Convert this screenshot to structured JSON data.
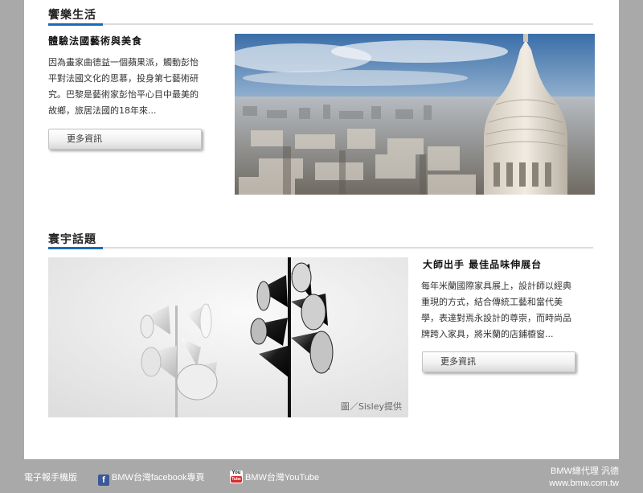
{
  "sections": {
    "lifestyle": {
      "heading": "饗樂生活",
      "article_title": "體驗法國藝術與美食",
      "article_body": [
        "因為畫家曲德益一個蘋果派，觸動彭怡",
        "平對法國文化的思慕，投身第七藝術研",
        "究。巴黎是藝術家彭怡平心目中最美的",
        "故鄉，旅居法國的18年來..."
      ],
      "more_label": "更多資訊"
    },
    "world": {
      "heading": "寰宇話題",
      "article_title": "大師出手  最佳品味伸展台",
      "article_body": [
        "每年米蘭國際家具展上，設計師以經典",
        "重現的方式，結合傳統工藝和當代美",
        "學，表達對焉永設計的尊崇，而時尚品",
        "牌跨入家具，將米蘭的店鋪櫥窗..."
      ],
      "more_label": "更多資訊",
      "photo_credit": "圖／Sisley提供"
    }
  },
  "footer": {
    "mobile_label": "電子報手機版",
    "facebook_label": "BMW台灣facebook專頁",
    "youtube_label": "BMW台灣YouTube",
    "dealer_line1": "BMW總代理 汎德",
    "dealer_line2": "www.bmw.com.tw"
  },
  "icons": [
    "facebook-icon",
    "youtube-icon"
  ],
  "colors": {
    "accent_blue": "#1c69b8",
    "background": "#a9a9a9",
    "panel": "#ffffff"
  }
}
